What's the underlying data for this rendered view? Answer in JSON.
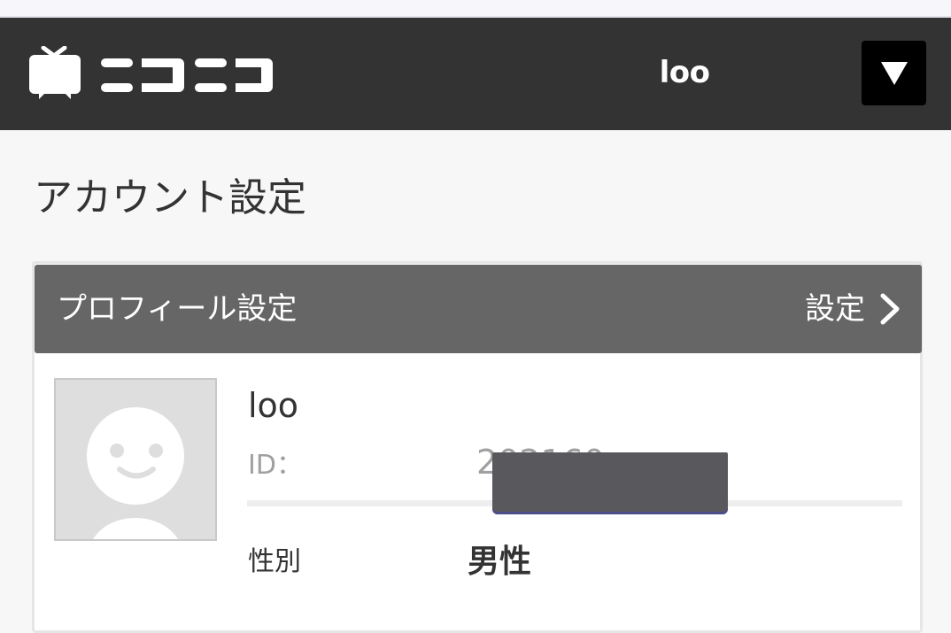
{
  "header": {
    "brand": "ニコニコ",
    "user_name": "loo",
    "menu_icon": "triangle-down-icon"
  },
  "page": {
    "title": "アカウント設定"
  },
  "profile_card": {
    "title": "プロフィール設定",
    "action_label": "設定",
    "action_icon": "chevron-right-icon",
    "avatar_icon": "default-avatar-icon",
    "name": "loo",
    "id_label": "ID：",
    "id_value": "2⁠0⁠2⁠1⁠6⁠0",
    "gender_label": "性別",
    "gender_value": "男性"
  },
  "colors": {
    "header_bg": "#333333",
    "card_header_bg": "#666666",
    "page_bg": "#f7f7f7",
    "menu_button_bg": "#000000"
  }
}
